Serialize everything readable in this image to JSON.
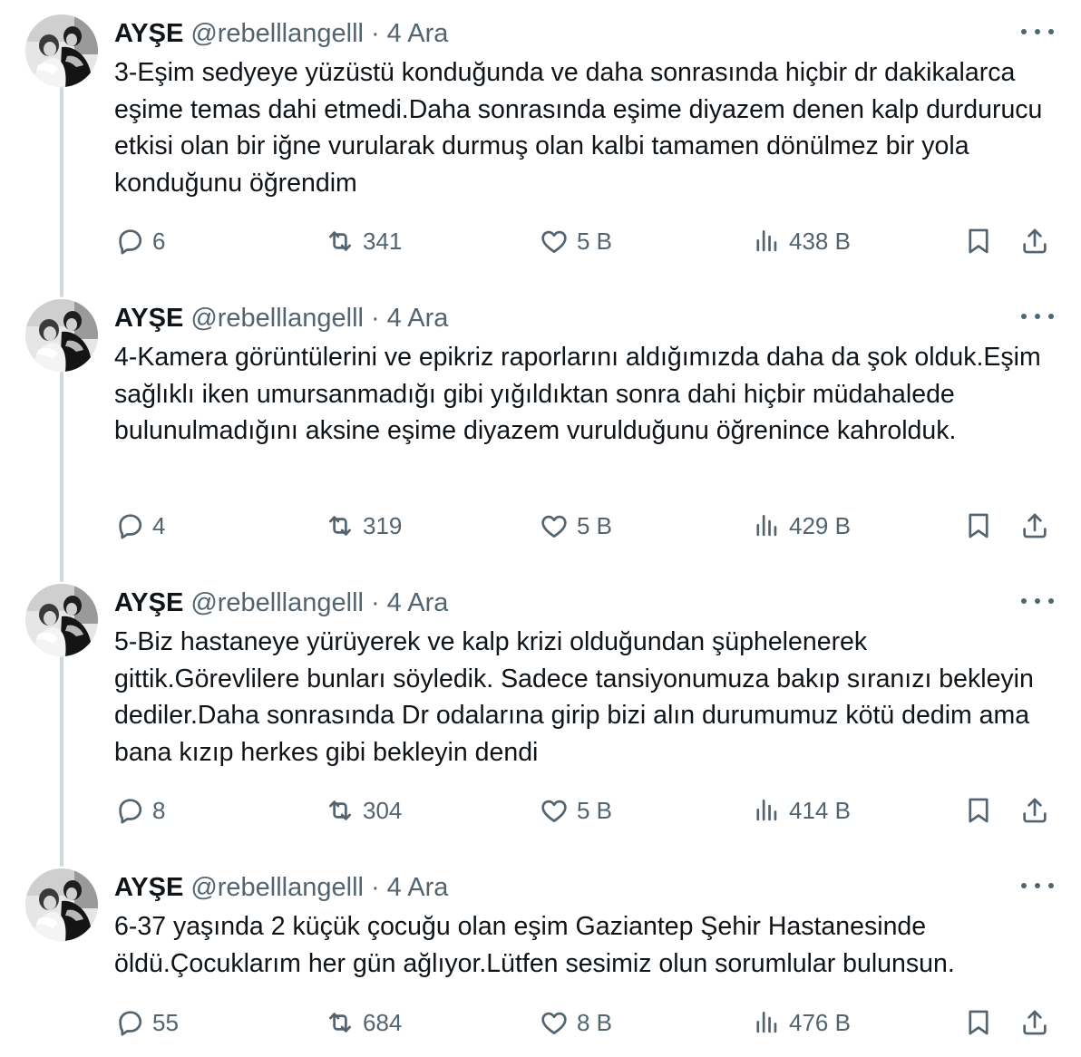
{
  "tweets": [
    {
      "name": "AYŞE",
      "handle": "@rebelllangelll",
      "separator": "·",
      "date": "4 Ara",
      "text": "3-Eşim sedyeye yüzüstü konduğunda ve daha sonrasında hiçbir dr dakikalarca eşime temas dahi etmedi.Daha sonrasında eşime diyazem denen kalp durdurucu etkisi olan bir iğne vurularak durmuş olan kalbi tamamen dönülmez bir yola konduğunu öğrendim",
      "replies": "6",
      "retweets": "341",
      "likes": "5 B",
      "views": "438 B"
    },
    {
      "name": "AYŞE",
      "handle": "@rebelllangelll",
      "separator": "·",
      "date": "4 Ara",
      "text": "4-Kamera görüntülerini ve epikriz raporlarını aldığımızda daha da şok olduk.Eşim sağlıklı iken umursanmadığı gibi yığıldıktan sonra dahi hiçbir müdahalede bulunulmadığını aksine eşime diyazem vurulduğunu öğrenince kahrolduk.",
      "replies": "4",
      "retweets": "319",
      "likes": "5 B",
      "views": "429 B"
    },
    {
      "name": "AYŞE",
      "handle": "@rebelllangelll",
      "separator": "·",
      "date": "4 Ara",
      "text": "5-Biz hastaneye yürüyerek ve kalp krizi olduğundan şüphelenerek gittik.Görevlilere bunları söyledik. Sadece tansiyonumuza bakıp sıranızı bekleyin dediler.Daha sonrasında Dr odalarına girip bizi alın durumumuz kötü dedim ama bana kızıp herkes gibi bekleyin dendi",
      "replies": "8",
      "retweets": "304",
      "likes": "5 B",
      "views": "414 B"
    },
    {
      "name": "AYŞE",
      "handle": "@rebelllangelll",
      "separator": "·",
      "date": "4 Ara",
      "text": "6-37 yaşında 2 küçük çocuğu olan eşim Gaziantep Şehir Hastanesinde öldü.Çocuklarım her gün ağlıyor.Lütfen sesimiz olun sorumlular bulunsun.",
      "replies": "55",
      "retweets": "684",
      "likes": "8 B",
      "views": "476 B"
    }
  ],
  "icons": {
    "reply": "reply-icon",
    "retweet": "retweet-icon",
    "like": "heart-icon",
    "views": "views-icon",
    "bookmark": "bookmark-icon",
    "share": "share-icon",
    "more": "more-icon"
  },
  "colors": {
    "text_primary": "#0f1419",
    "text_secondary": "#536471",
    "thread_line": "#cfd9de",
    "background": "#ffffff"
  }
}
